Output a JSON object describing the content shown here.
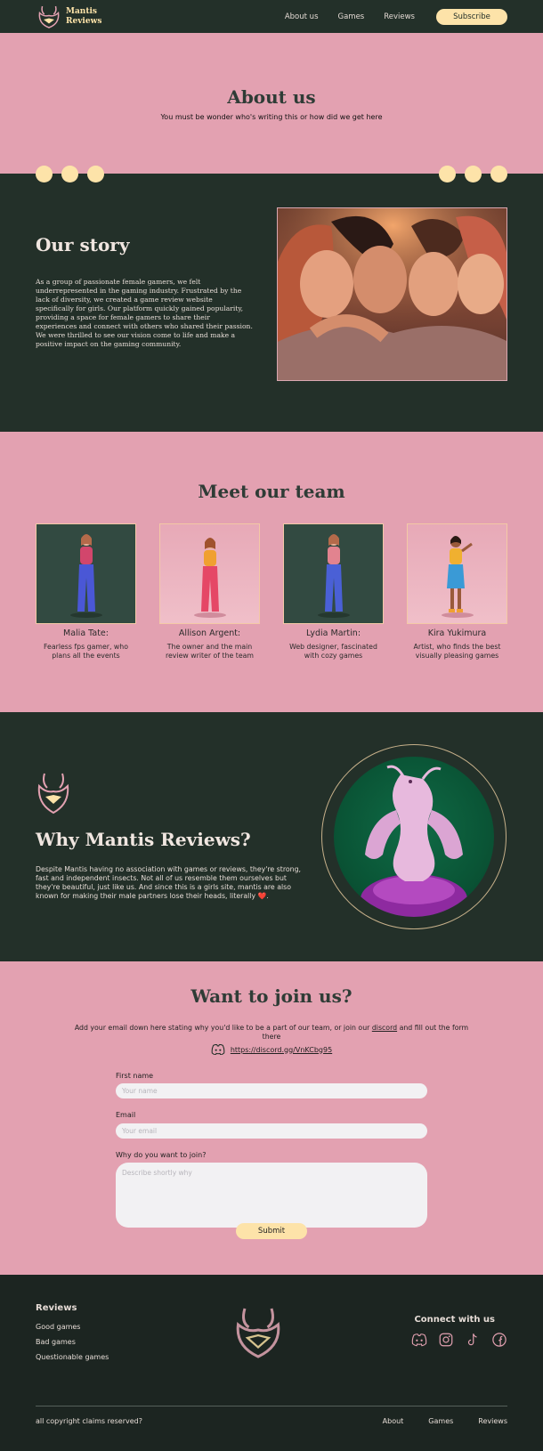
{
  "brand": {
    "line1": "Mantis",
    "line2": "Reviews"
  },
  "nav": {
    "links": [
      "About us",
      "Games",
      "Reviews"
    ],
    "subscribe": "Subscribe"
  },
  "hero": {
    "title": "About us",
    "subtitle": "You must be wonder who's writing this or how did we get here"
  },
  "story": {
    "title": "Our story",
    "text": "As a group of passionate female gamers, we felt underrepresented in the gaming industry. Frustrated by the lack of diversity, we created a game review website specifically for girls. Our platform quickly gained popularity, providing a space for female gamers to share their experiences and connect with others who shared their passion. We were thrilled to see our vision come to life and make a positive impact on the gaming community."
  },
  "team": {
    "title": "Meet our team",
    "members": [
      {
        "name": "Malia Tate:",
        "desc": "Fearless fps gamer, who plans all the events"
      },
      {
        "name": "Allison Argent:",
        "desc": "The owner and the main review writer of the team"
      },
      {
        "name": "Lydia Martin:",
        "desc": "Web designer, fascinated with cozy games"
      },
      {
        "name": "Kira Yukimura",
        "desc": "Artist, who finds the best visually pleasing games"
      }
    ]
  },
  "why": {
    "title": "Why Mantis Reviews?",
    "text": "Despite Mantis having no association with games or reviews, they're strong, fast and independent insects. Not all of us resemble them ourselves but they're beautiful, just like us. And since this is a girls site, mantis are also known for making their male partners lose their heads, literally",
    "emoji": "❤️",
    "period": "."
  },
  "join": {
    "title": "Want to join us?",
    "intro_before": "Add your email down here stating why you'd like to be a part of our team, or join our ",
    "intro_link": "discord",
    "intro_after": " and fill out the form there",
    "discord_url": "https://discord.gg/VnKCbg95",
    "first_name_label": "First name",
    "first_name_placeholder": "Your name",
    "email_label": "Email",
    "email_placeholder": "Your email",
    "why_label": "Why do you want to join?",
    "why_placeholder": "Describe shortly why",
    "submit": "Submit"
  },
  "footer": {
    "title": "Reviews",
    "links": [
      "Good games",
      "Bad games",
      "Questionable games"
    ],
    "connect": "Connect with us",
    "copyright": "all copyright claims reserved?",
    "bottom_links": [
      "About",
      "Games",
      "Reviews"
    ]
  },
  "colors": {
    "dark": "#233029",
    "pink": "#e3a1b1",
    "cream": "#fde3a9",
    "footer": "#1c2521"
  }
}
